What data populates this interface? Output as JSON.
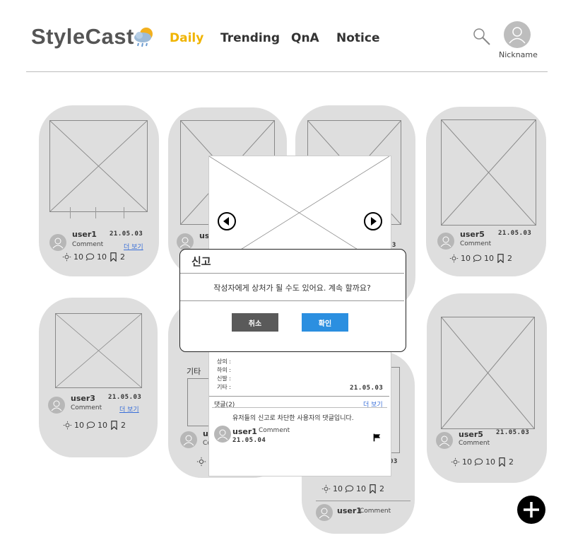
{
  "brand": {
    "name": "StyleCast"
  },
  "nav": [
    {
      "label": "Daily",
      "active": true
    },
    {
      "label": "Trending",
      "active": false
    },
    {
      "label": "QnA",
      "active": false
    },
    {
      "label": "Notice",
      "active": false
    }
  ],
  "user": {
    "nickname": "Nickname"
  },
  "cards": [
    {
      "user": "user1",
      "comment": "Comment",
      "date": "21.05.03",
      "more": "더 보기",
      "likes": "10",
      "comments": "10",
      "saves": "2"
    },
    {
      "user": "user3",
      "comment": "Comment",
      "date": "21.05.03",
      "more": "더 보기",
      "likes": "10",
      "comments": "10",
      "saves": "2"
    },
    {
      "user": "user5",
      "comment": "Comment",
      "date": "21.05.03",
      "likes": "10",
      "comments": "10",
      "saves": "2"
    },
    {
      "user": "user5",
      "comment": "Comment",
      "date": "21.05.03",
      "likes": "10",
      "comments": "10",
      "saves": "2"
    },
    {
      "user": "us",
      "comment": "Co"
    },
    {
      "user": "us",
      "comment": "Co"
    },
    {
      "user": "user1",
      "comment": "Comment",
      "date": "03",
      "date2": "03",
      "likes": "10",
      "comments": "10",
      "saves": "2"
    }
  ],
  "detail": {
    "fields": [
      "상의 :",
      "하의 :",
      "신발 :",
      "기타 :"
    ],
    "side_label": "기타",
    "date": "21.05.03",
    "comments_header": "댓글(2)",
    "more": "더 보기",
    "blocked_msg": "유저들의 신고로 차단한 사용자의 댓글입니다.",
    "reply": {
      "user": "user1",
      "comment": "Comment",
      "date": "21.05.04"
    }
  },
  "modal": {
    "title": "신고",
    "message": "작성자에게 상처가 될 수도 있어요. 계속 할까요?",
    "cancel": "취소",
    "confirm": "확인",
    "cancel_color": "#5a5a5a",
    "confirm_color": "#2b8fe0"
  },
  "icons": [
    "cloud-icon",
    "search-icon",
    "avatar-icon",
    "mouse-icon",
    "sun-icon",
    "comment-icon",
    "bookmark-icon",
    "flag-icon",
    "prev-icon",
    "next-icon",
    "plus-icon"
  ]
}
